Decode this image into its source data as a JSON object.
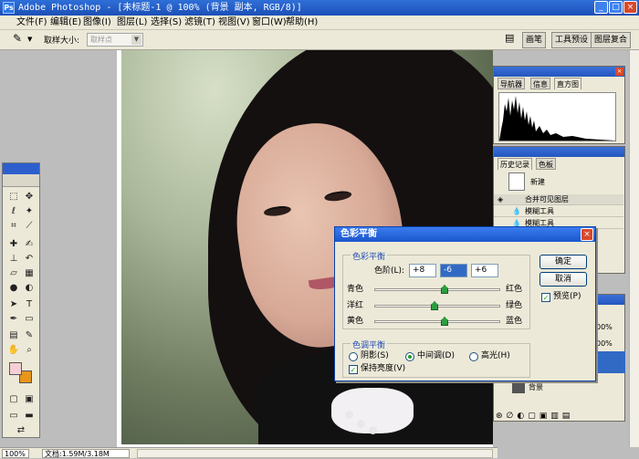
{
  "window": {
    "title": "Adobe Photoshop - [未标题-1 @ 100% (背景 副本, RGB/8)]",
    "app_icon": "Ps",
    "minimize_glyph": "_",
    "maximize_glyph": "□",
    "close_glyph": "×"
  },
  "menu": [
    "文件(F)",
    "编辑(E)",
    "图像(I)",
    "图层(L)",
    "选择(S)",
    "滤镜(T)",
    "视图(V)",
    "窗口(W)",
    "帮助(H)"
  ],
  "options": {
    "sample_size_label": "取样大小:",
    "sample_size_value": "取样点",
    "dropdown_glyph": "▼",
    "well_tabs": [
      "画笔",
      "工具预设",
      "图层复合"
    ]
  },
  "status": {
    "zoom": "100%",
    "doc_size": "文档:1.59M/3.18M"
  },
  "navigator_panel": {
    "tabs": [
      "导航器",
      "信息",
      "直方图"
    ],
    "close_glyph": "×"
  },
  "history_panel": {
    "tabs": [
      "历史记录",
      "色板"
    ],
    "snapshot_label": "新建",
    "items": [
      "合并可见图层",
      "模糊工具",
      "模糊工具"
    ]
  },
  "layers_panel": {
    "opacity_value": "00%",
    "fill_value": "00%",
    "layer_name": "背景"
  },
  "color_balance_dialog": {
    "title": "色彩平衡",
    "close_glyph": "×",
    "balance_group": "色彩平衡",
    "levels_label": "色阶(L):",
    "level1": "+8",
    "level2": "-6",
    "level3": "+6",
    "cyan": "青色",
    "red": "红色",
    "magenta": "洋红",
    "green": "绿色",
    "yellow": "黄色",
    "blue": "蓝色",
    "tone_group": "色调平衡",
    "shadows": "阴影(S)",
    "midtones": "中间调(D)",
    "highlights": "高光(H)",
    "preserve_luminosity": "保持亮度(V)",
    "ok": "确定",
    "cancel": "取消",
    "preview": "预览(P)",
    "check_glyph": "✓"
  },
  "icons": [
    "eyedropper-icon",
    "marquee-icon",
    "move-icon",
    "lasso-icon",
    "magic-wand-icon",
    "crop-icon",
    "slice-icon",
    "healing-icon",
    "brush-icon",
    "stamp-icon",
    "history-brush-icon",
    "eraser-icon",
    "gradient-icon",
    "blur-icon",
    "dodge-icon",
    "path-select-icon",
    "type-icon",
    "pen-icon",
    "shape-icon",
    "notes-icon",
    "eyedropper-tool-icon",
    "hand-icon",
    "zoom-icon",
    "quick-mask-icon",
    "screen-mode-icon",
    "jump-to-imageready-icon"
  ]
}
